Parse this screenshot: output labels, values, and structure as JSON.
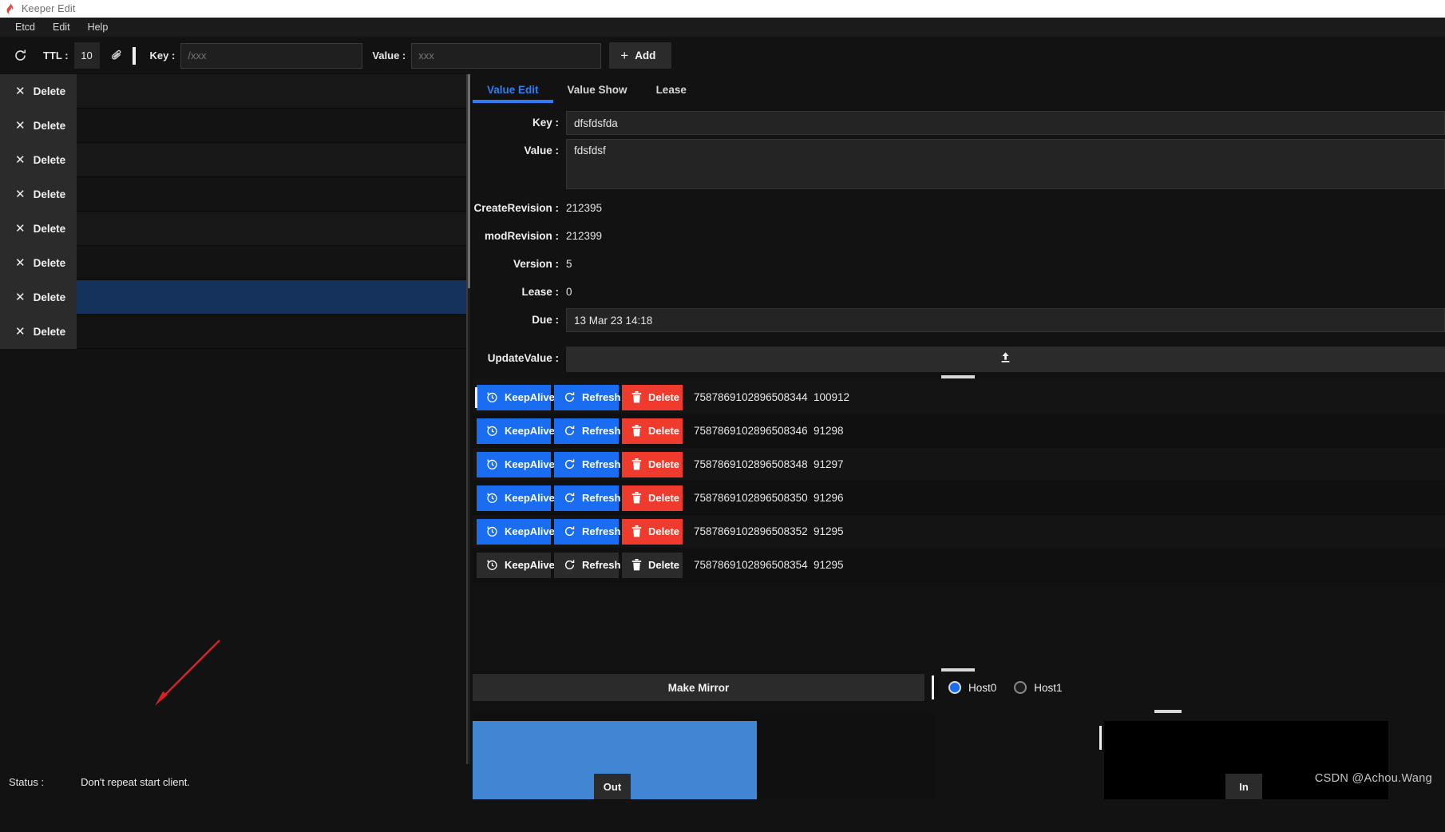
{
  "window": {
    "title": "Keeper Edit",
    "icon": "flame-icon"
  },
  "menubar": {
    "items": [
      "Etcd",
      "Edit",
      "Help"
    ]
  },
  "toolbar": {
    "refresh_icon": "refresh-icon",
    "ttl_label": "TTL :",
    "ttl_value": "10",
    "clip_icon": "paperclip-icon",
    "key_label": "Key :",
    "key_placeholder": "/xxx",
    "key_value": "",
    "value_label": "Value :",
    "value_placeholder": "xxx",
    "value_value": "",
    "add_label": "Add",
    "add_icon": "plus-icon"
  },
  "left_list": {
    "delete_label": "Delete",
    "delete_icon": "close-x-icon",
    "rows": [
      {
        "text": "",
        "selected": false
      },
      {
        "text": "",
        "selected": false
      },
      {
        "text": "",
        "selected": false
      },
      {
        "text": "",
        "selected": false
      },
      {
        "text": "",
        "selected": false
      },
      {
        "text": "",
        "selected": false
      },
      {
        "text": "",
        "selected": true
      },
      {
        "text": "",
        "selected": false
      }
    ]
  },
  "status": {
    "label": "Status :",
    "message": "Don't repeat start client."
  },
  "tabs": [
    {
      "label": "Value Edit",
      "active": true
    },
    {
      "label": "Value Show",
      "active": false
    },
    {
      "label": "Lease",
      "active": false
    }
  ],
  "form": {
    "key_label": "Key :",
    "key_value": "dfsfdsfda",
    "value_label": "Value :",
    "value_value": "fdsfdsf",
    "create_revision_label": "CreateRevision :",
    "create_revision_value": "212395",
    "mod_revision_label": "modRevision :",
    "mod_revision_value": "212399",
    "version_label": "Version :",
    "version_value": "5",
    "lease_label": "Lease :",
    "lease_value": "0",
    "due_label": "Due :",
    "due_value": "13 Mar 23 14:18",
    "update_value_label": "UpdateValue :",
    "update_value_value": "",
    "upload_icon": "upload-icon"
  },
  "lease_table": {
    "keepalive_label": "KeepAlive",
    "keepalive_icon": "clock-rewind-icon",
    "refresh_label": "Refresh",
    "refresh_icon": "refresh-icon",
    "delete_label": "Delete",
    "delete_icon": "trash-icon",
    "rows": [
      {
        "id": "7587869102896508344",
        "ttl": "100912",
        "muted": false
      },
      {
        "id": "7587869102896508346",
        "ttl": "91298",
        "muted": false
      },
      {
        "id": "7587869102896508348",
        "ttl": "91297",
        "muted": false
      },
      {
        "id": "7587869102896508350",
        "ttl": "91296",
        "muted": false
      },
      {
        "id": "7587869102896508352",
        "ttl": "91295",
        "muted": false
      },
      {
        "id": "7587869102896508354",
        "ttl": "91295",
        "muted": true
      }
    ]
  },
  "mirror": {
    "button_label": "Make Mirror",
    "hosts": [
      {
        "label": "Host0",
        "selected": true
      },
      {
        "label": "Host1",
        "selected": false
      }
    ]
  },
  "bottom_panels": {
    "out_label": "Out",
    "in_label": "In"
  },
  "watermark": "CSDN @Achou.Wang",
  "colors": {
    "accent_blue": "#1a6cf0",
    "tab_blue": "#2f7df4",
    "danger_red": "#ef3b2d",
    "selection_blue": "#14325c",
    "panel_blue": "#4186d3",
    "annotation_red": "#e02020"
  }
}
